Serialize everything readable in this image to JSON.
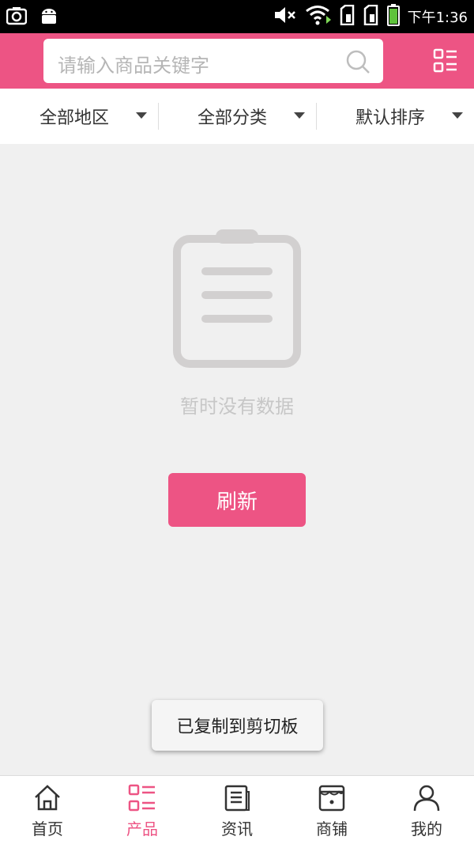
{
  "status_bar": {
    "time": "下午1:36",
    "icons": [
      "screenshot-icon",
      "android-icon",
      "mute-icon",
      "wifi-icon",
      "sim-card-icon",
      "sim-card-icon",
      "battery-icon"
    ]
  },
  "header": {
    "search_placeholder": "请输入商品关键字",
    "icons": [
      "search-icon",
      "category-menu-icon"
    ]
  },
  "filters": [
    {
      "label": "全部地区"
    },
    {
      "label": "全部分类"
    },
    {
      "label": "默认排序"
    }
  ],
  "empty_state": {
    "icon": "clipboard-icon",
    "message": "暂时没有数据",
    "refresh_label": "刷新"
  },
  "toast": {
    "message": "已复制到剪切板"
  },
  "bottom_nav": {
    "items": [
      {
        "label": "首页",
        "icon": "home-icon",
        "active": false
      },
      {
        "label": "产品",
        "icon": "product-list-icon",
        "active": true
      },
      {
        "label": "资讯",
        "icon": "news-icon",
        "active": false
      },
      {
        "label": "商铺",
        "icon": "store-icon",
        "active": false
      },
      {
        "label": "我的",
        "icon": "user-icon",
        "active": false
      }
    ]
  },
  "colors": {
    "brand": "#ed5484",
    "background": "#f0f0f0",
    "empty_icon": "#d2d0d0"
  }
}
